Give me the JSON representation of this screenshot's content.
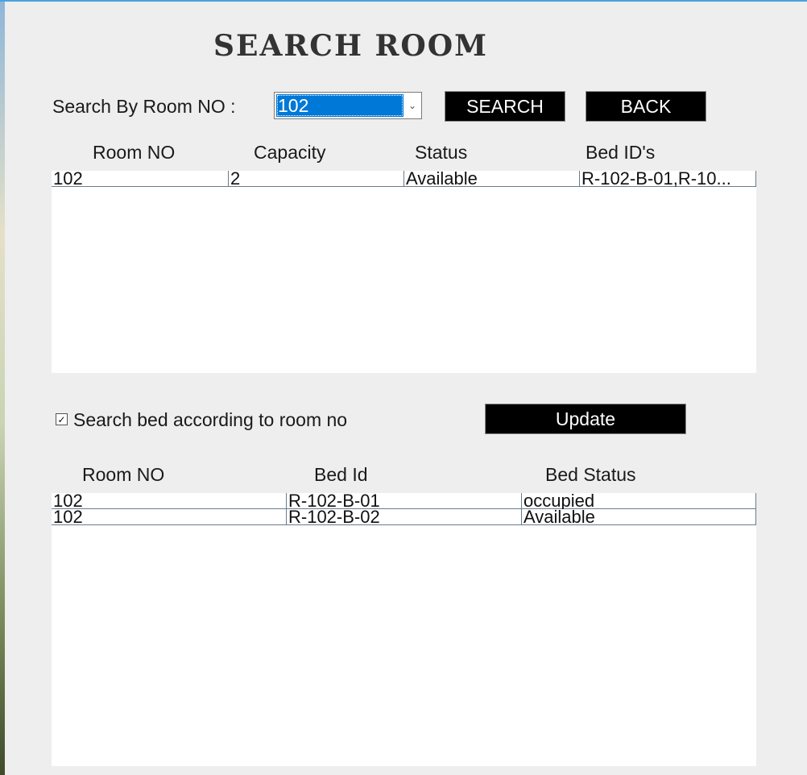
{
  "title": "SEARCH ROOM",
  "search": {
    "label": "Search By Room NO :",
    "selected_room": "102",
    "search_button": "SEARCH",
    "back_button": "BACK"
  },
  "rooms_table": {
    "headers": [
      "Room NO",
      "Capacity",
      "Status",
      "Bed ID's"
    ],
    "rows": [
      [
        "102",
        "2",
        "Available",
        "R-102-B-01,R-10..."
      ]
    ]
  },
  "bed_search": {
    "checkbox_label": "Search bed according to room no",
    "checked": true,
    "update_button": "Update"
  },
  "beds_table": {
    "headers": [
      "Room NO",
      "Bed Id",
      "Bed Status"
    ],
    "rows": [
      [
        "102",
        "R-102-B-01",
        "occupied"
      ],
      [
        "102",
        "R-102-B-02",
        "Available"
      ]
    ]
  },
  "colors": {
    "background": "#eeeeee",
    "button_bg": "#000000",
    "selection": "#0078d7"
  }
}
